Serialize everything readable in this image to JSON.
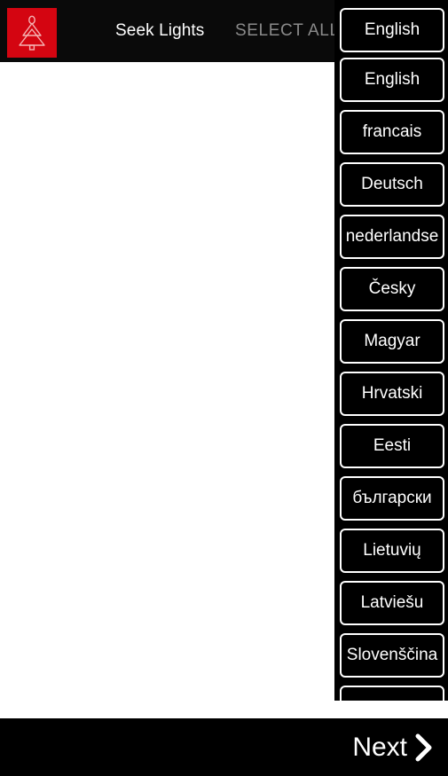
{
  "header": {
    "app_icon_name": "christmas-tree-icon",
    "app_icon_bg": "#d40511",
    "title": "Seek Lights",
    "select_all_label": "SELECT ALL",
    "select_all_color": "#8a8a8a",
    "background": "#0a0a0a"
  },
  "language_panel": {
    "selected": "English",
    "items": [
      {
        "label": "English"
      },
      {
        "label": "francais"
      },
      {
        "label": "Deutsch"
      },
      {
        "label": "nederlandse"
      },
      {
        "label": "Česky"
      },
      {
        "label": "Magyar"
      },
      {
        "label": "Hrvatski"
      },
      {
        "label": "Eesti"
      },
      {
        "label": "български"
      },
      {
        "label": "Lietuvių"
      },
      {
        "label": "Latviešu"
      },
      {
        "label": "Slovenščina"
      },
      {
        "label": ""
      }
    ]
  },
  "bottom_bar": {
    "next_label": "Next",
    "next_icon_name": "chevron-right-icon",
    "background": "#000000"
  }
}
